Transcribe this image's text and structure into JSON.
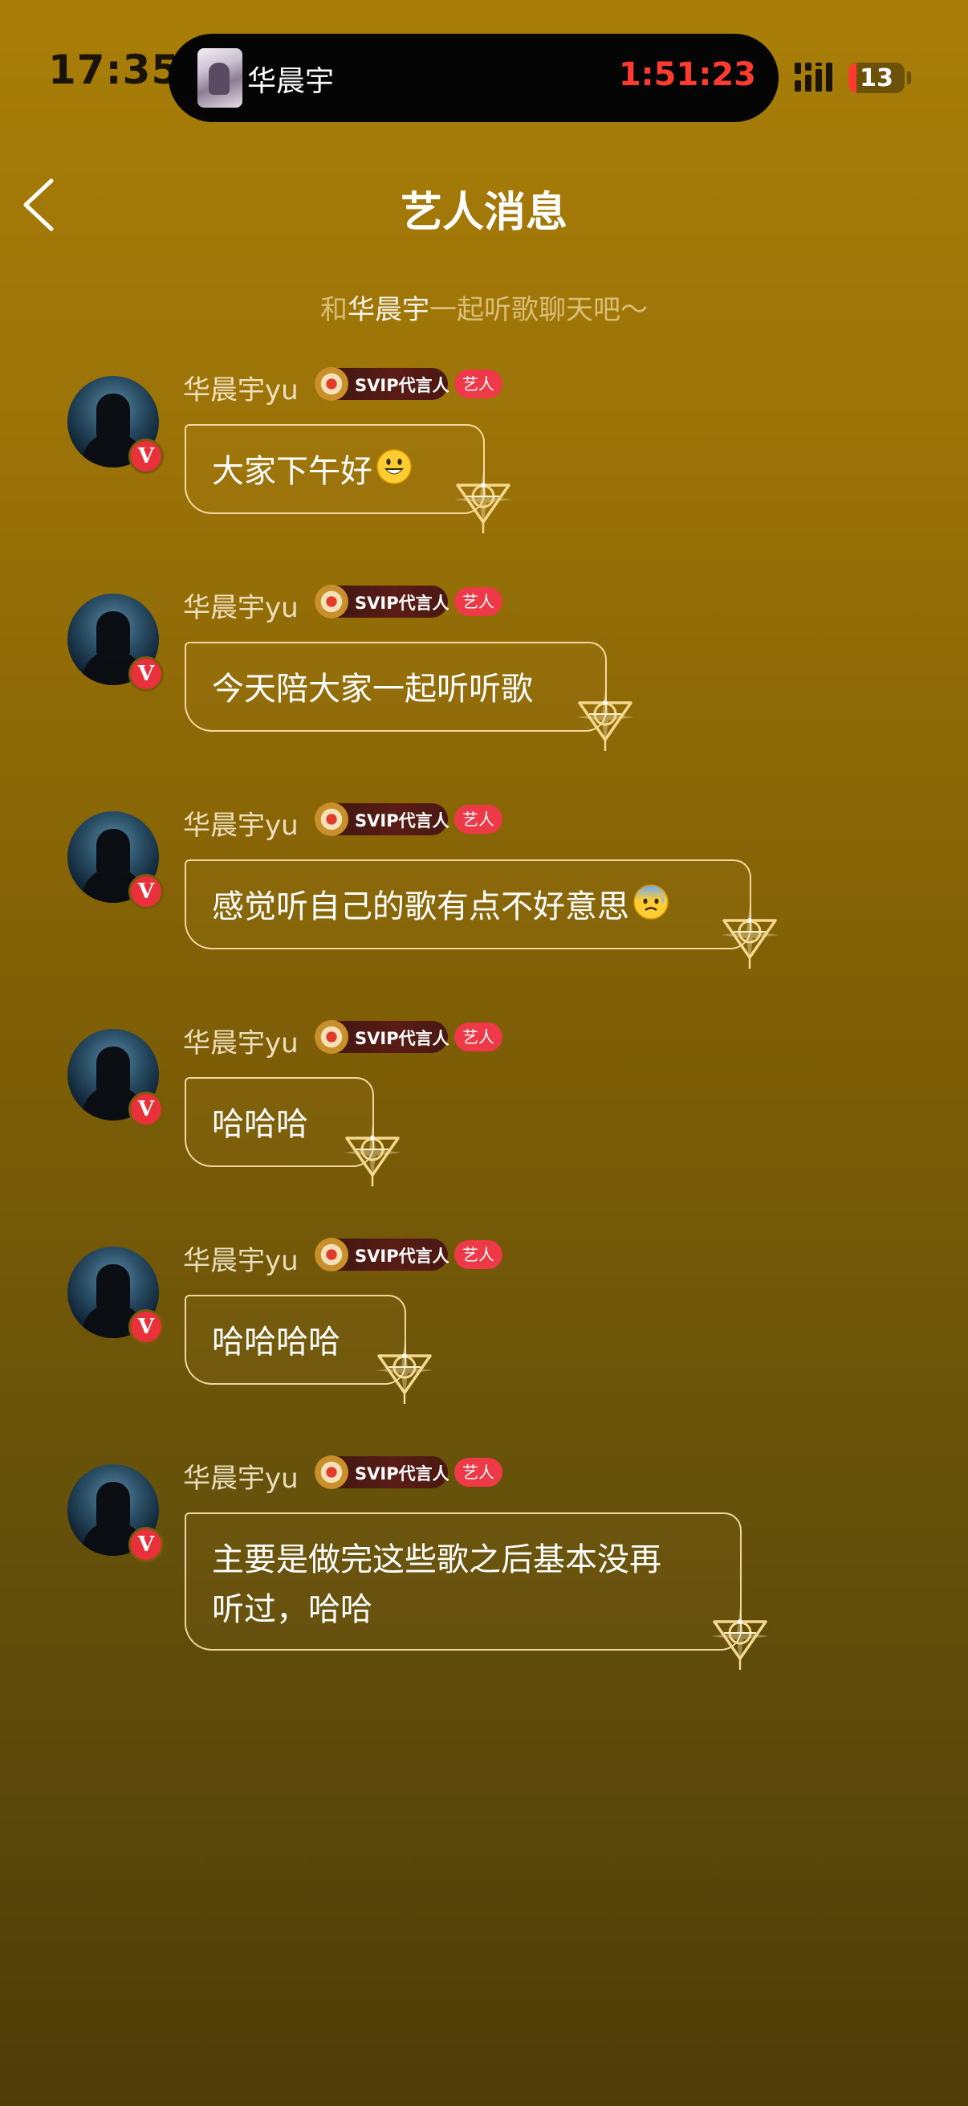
{
  "status_bar": {
    "time": "17:35",
    "now_playing_artist": "华晨宇",
    "timer": "1:51:23",
    "battery": "13"
  },
  "header": {
    "title": "艺人消息",
    "subtitle_prefix": "和",
    "subtitle_artist": "华晨宇",
    "subtitle_suffix": "一起听歌聊天吧～"
  },
  "messages": [
    {
      "sender": "华晨宇yu",
      "badge": "SVIP代言人",
      "tag": "艺人",
      "text": "大家下午好",
      "emoji": "smiling-face-icon"
    },
    {
      "sender": "华晨宇yu",
      "badge": "SVIP代言人",
      "tag": "艺人",
      "text": "今天陪大家一起听听歌"
    },
    {
      "sender": "华晨宇yu",
      "badge": "SVIP代言人",
      "tag": "艺人",
      "text": "感觉听自己的歌有点不好意思",
      "emoji": "anxious-face-icon"
    },
    {
      "sender": "华晨宇yu",
      "badge": "SVIP代言人",
      "tag": "艺人",
      "text": "哈哈哈"
    },
    {
      "sender": "华晨宇yu",
      "badge": "SVIP代言人",
      "tag": "艺人",
      "text": "哈哈哈哈"
    },
    {
      "sender": "华晨宇yu",
      "badge": "SVIP代言人",
      "tag": "艺人",
      "text": "主要是做完这些歌之后基本没再\n听过，哈哈"
    }
  ],
  "colors": {
    "background_top": "#a97e08",
    "background_bottom": "#4f3d09",
    "accent_red": "#ff3b30",
    "bubble_border": "#ffe4af"
  }
}
